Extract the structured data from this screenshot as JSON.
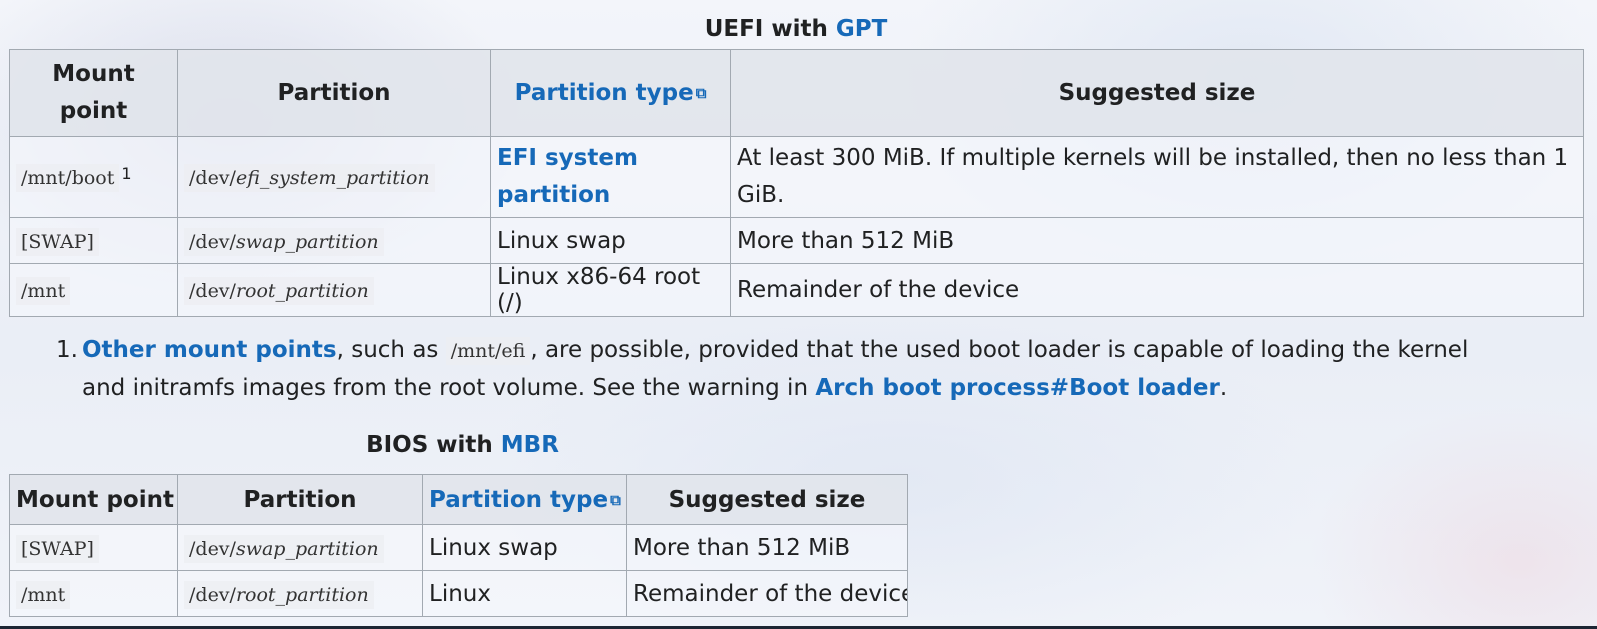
{
  "uefi": {
    "caption_prefix": "UEFI with ",
    "caption_link": "GPT",
    "headers": {
      "mount_point": "Mount point",
      "partition": "Partition",
      "partition_type": "Partition type",
      "suggested_size": "Suggested size"
    },
    "rows": [
      {
        "mount": "/mnt/boot",
        "mount_sup": "1",
        "partition_prefix": "/dev/",
        "partition_name": "efi_system_partition",
        "type": "EFI system partition",
        "size": "At least 300 MiB. If multiple kernels will be installed, then no less than 1 GiB."
      },
      {
        "mount": "[SWAP]",
        "partition_prefix": "/dev/",
        "partition_name": "swap_partition",
        "type": "Linux swap",
        "size": "More than 512 MiB"
      },
      {
        "mount": "/mnt",
        "partition_prefix": "/dev/",
        "partition_name": "root_partition",
        "type": "Linux x86-64 root (/)",
        "size": "Remainder of the device"
      }
    ]
  },
  "note": {
    "number": "1.",
    "link1": "Other mount points",
    "text1": ", such as ",
    "code": "/mnt/efi",
    "text2": ", are possible, provided that the used boot loader is capable of loading the kernel and initramfs images from the root volume. See the warning in ",
    "link2": "Arch boot process#Boot loader",
    "text3": "."
  },
  "bios": {
    "caption_prefix": "BIOS with ",
    "caption_link": "MBR",
    "headers": {
      "mount_point": "Mount point",
      "partition": "Partition",
      "partition_type": "Partition type",
      "suggested_size": "Suggested size"
    },
    "rows": [
      {
        "mount": "[SWAP]",
        "partition_prefix": "/dev/",
        "partition_name": "swap_partition",
        "type": "Linux swap",
        "size": "More than 512 MiB"
      },
      {
        "mount": "/mnt",
        "partition_prefix": "/dev/",
        "partition_name": "root_partition",
        "type": "Linux",
        "size": "Remainder of the device"
      }
    ]
  },
  "icons": {
    "external_link": "external-link-icon"
  },
  "colors": {
    "link": "#1669b8",
    "border": "#a2a9b1",
    "text": "#202122"
  }
}
